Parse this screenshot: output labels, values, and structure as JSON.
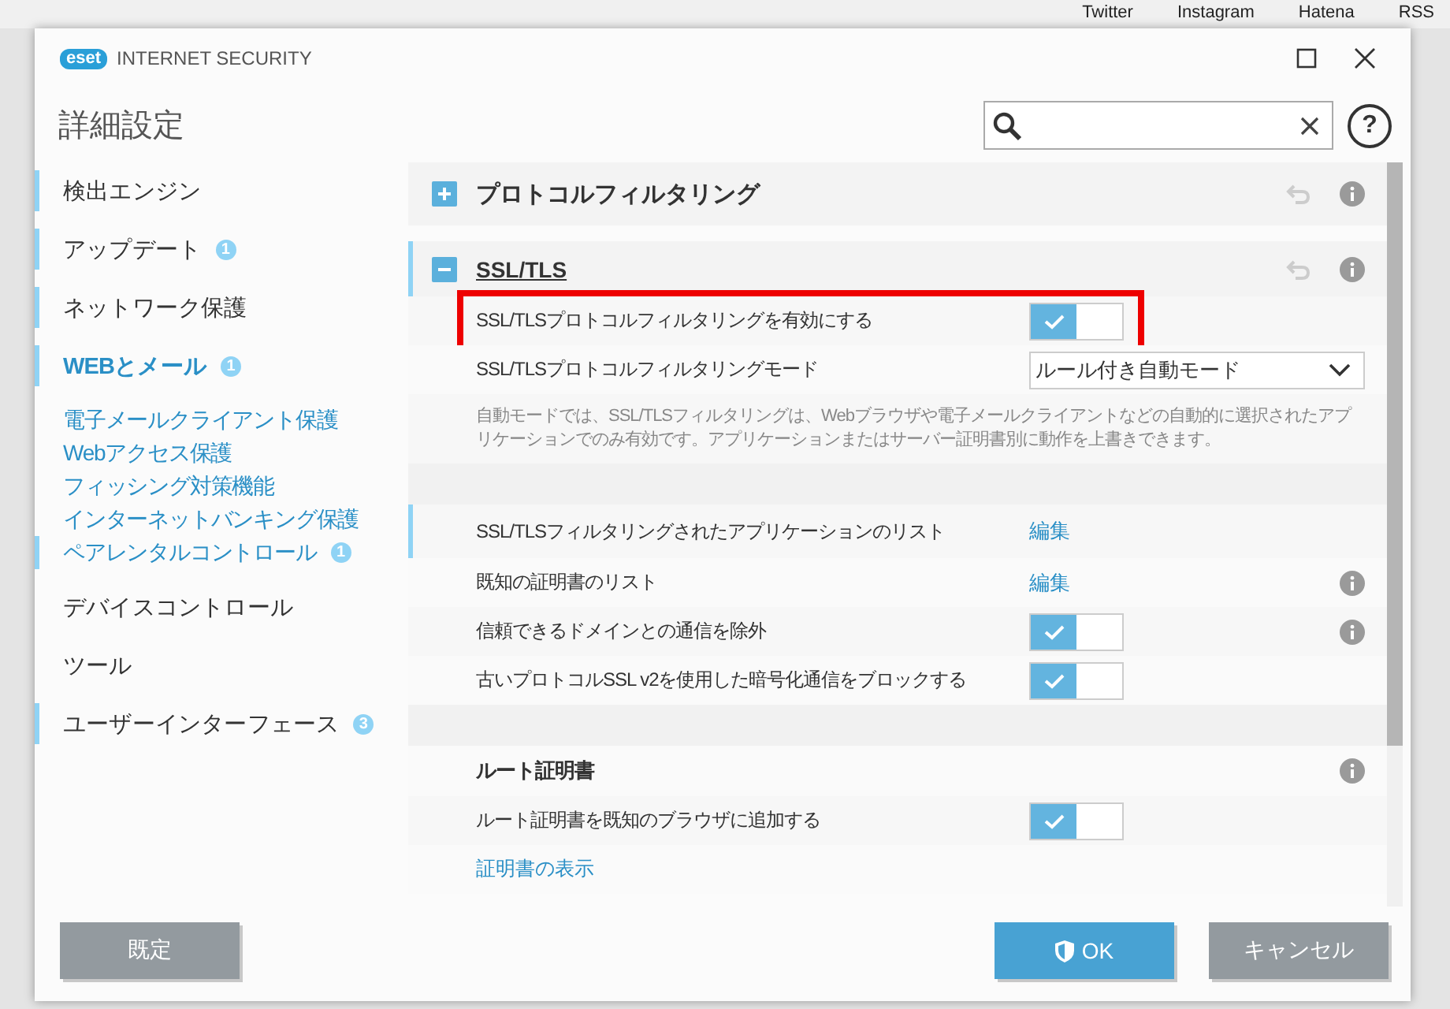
{
  "background_page": {
    "links": [
      "Twitter",
      "Instagram",
      "Hatena",
      "RSS"
    ]
  },
  "window": {
    "brand": "eset",
    "title": "INTERNET SECURITY"
  },
  "heading": "詳細設定",
  "help": "?",
  "sidebar": [
    {
      "label": "検出エンジン",
      "marked": true,
      "selected": false
    },
    {
      "label": "アップデート",
      "badge": "1",
      "marked": true,
      "selected": false
    },
    {
      "label": "ネットワーク保護",
      "marked": true,
      "selected": false
    },
    {
      "label": "WEBとメール",
      "badge": "1",
      "marked": true,
      "selected": true,
      "children": [
        {
          "label": "電子メールクライアント保護",
          "marked": false
        },
        {
          "label": "Webアクセス保護",
          "marked": false
        },
        {
          "label": "フィッシング対策機能",
          "marked": false
        },
        {
          "label": "インターネットバンキング保護",
          "marked": false
        },
        {
          "label": "ペアレンタルコントロール",
          "badge": "1",
          "marked": true
        }
      ]
    },
    {
      "label": "デバイスコントロール",
      "marked": false,
      "selected": false
    },
    {
      "label": "ツール",
      "marked": false,
      "selected": false
    },
    {
      "label": "ユーザーインターフェース",
      "badge": "3",
      "marked": true,
      "selected": false
    }
  ],
  "sections": [
    {
      "title": "プロトコルフィルタリング",
      "expanded": false,
      "marked": false
    },
    {
      "title": "SSL/TLS",
      "expanded": true,
      "marked": true,
      "rows": [
        {
          "kind": "toggle",
          "label": "SSL/TLSプロトコルフィルタリングを有効にする",
          "checked": true,
          "highlighted": true,
          "info": false,
          "marked": false
        },
        {
          "kind": "dropdown",
          "label": "SSL/TLSプロトコルフィルタリングモード",
          "value": "ルール付き自動モード",
          "info": false,
          "marked": false
        },
        {
          "kind": "description",
          "label": "自動モードでは、SSL/TLSフィルタリングは、Webブラウザや電子メールクライアントなどの自動的に選択されたアプリケーションでのみ有効です。アプリケーションまたはサーバー証明書別に動作を上書きできます。",
          "info": false,
          "marked": false
        },
        {
          "kind": "spacer",
          "info": false,
          "marked": false
        },
        {
          "kind": "link",
          "label": "SSL/TLSフィルタリングされたアプリケーションのリスト",
          "action": "編集",
          "info": false,
          "marked": true
        },
        {
          "kind": "link",
          "label": "既知の証明書のリスト",
          "action": "編集",
          "info": true,
          "marked": false
        },
        {
          "kind": "toggle",
          "label": "信頼できるドメインとの通信を除外",
          "checked": true,
          "highlighted": false,
          "info": true,
          "marked": false
        },
        {
          "kind": "toggle",
          "label": "古いプロトコルSSL v2を使用した暗号化通信をブロックする",
          "checked": true,
          "highlighted": false,
          "info": false,
          "marked": false
        },
        {
          "kind": "spacer",
          "info": false,
          "marked": false
        },
        {
          "kind": "heading",
          "label": "ルート証明書",
          "info": true,
          "marked": false
        },
        {
          "kind": "toggle",
          "label": "ルート証明書を既知のブラウザに追加する",
          "checked": true,
          "highlighted": false,
          "info": false,
          "marked": false
        },
        {
          "kind": "textlink",
          "label": "証明書の表示",
          "info": false,
          "marked": false
        }
      ]
    }
  ],
  "buttons": [
    {
      "label": "既定",
      "kind": "secondary"
    },
    {
      "label": "OK",
      "kind": "primary"
    },
    {
      "label": "キャンセル",
      "kind": "secondary"
    }
  ]
}
